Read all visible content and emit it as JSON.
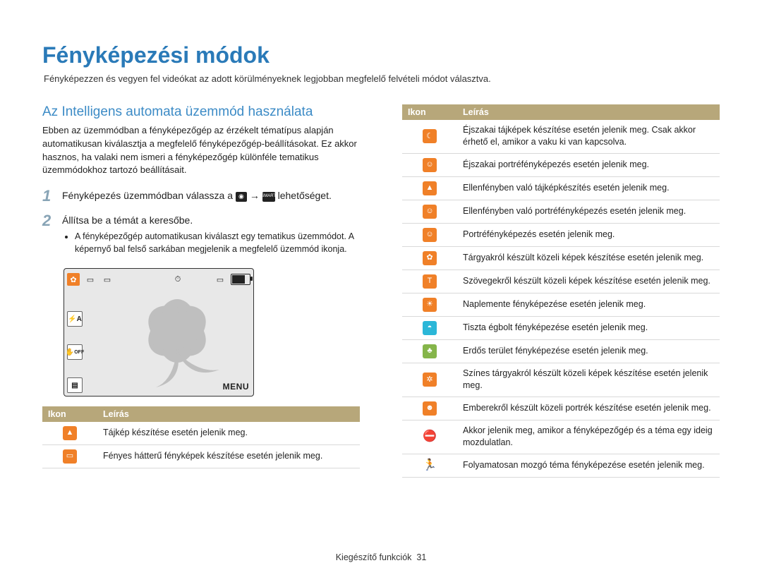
{
  "page": {
    "title": "Fényképezési módok",
    "subtitle": "Fényképezzen és vegyen fel videókat az adott körülményeknek legjobban megfelelő felvételi módot választva."
  },
  "section": {
    "title": "Az Intelligens automata üzemmód használata",
    "body": "Ebben az üzemmódban a fényképezőgép az érzékelt tématípus alapján automatikusan kiválasztja a megfelelő fényképezőgép-beállításokat. Ez akkor hasznos, ha valaki nem ismeri a fényképezőgép különféle tematikus üzemmódokhoz tartozó beállításait."
  },
  "steps": {
    "one_num": "1",
    "one_pre": "Fényképezés üzemmódban válassza a ",
    "one_arrow": " → ",
    "one_post": " lehetőséget.",
    "two_num": "2",
    "two_text": "Állítsa be a témát a keresőbe.",
    "two_bullet": "A fényképezőgép automatikusan kiválaszt egy tematikus üzemmódot. A képernyő bal felső sarkában megjelenik a megfelelő üzemmód ikonja."
  },
  "preview": {
    "menu_label": "MENU"
  },
  "tables": {
    "header_icon": "Ikon",
    "header_desc": "Leírás"
  },
  "left_rows": [
    {
      "icon": "mountain-icon",
      "color": "orange",
      "glyph": "▲",
      "desc": "Tájkép készítése esetén jelenik meg."
    },
    {
      "icon": "white-bg-icon",
      "color": "orange",
      "glyph": "▭",
      "desc": "Fényes hátterű fényképek készítése esetén jelenik meg."
    }
  ],
  "right_rows": [
    {
      "icon": "night-landscape-icon",
      "color": "orange",
      "glyph": "☾",
      "desc": "Éjszakai tájképek készítése esetén jelenik meg. Csak akkor érhető el, amikor a vaku ki van kapcsolva."
    },
    {
      "icon": "night-portrait-icon",
      "color": "orange",
      "glyph": "☺",
      "desc": "Éjszakai portréfényképezés esetén jelenik meg."
    },
    {
      "icon": "backlight-land-icon",
      "color": "orange",
      "glyph": "▲",
      "desc": "Ellenfényben való tájképkészítés esetén jelenik meg."
    },
    {
      "icon": "backlight-port-icon",
      "color": "orange",
      "glyph": "☺",
      "desc": "Ellenfényben való portréfényképezés esetén jelenik meg."
    },
    {
      "icon": "portrait-icon",
      "color": "orange",
      "glyph": "☺",
      "desc": "Portréfényképezés esetén jelenik meg."
    },
    {
      "icon": "macro-icon",
      "color": "orange",
      "glyph": "✿",
      "desc": "Tárgyakról készült közeli képek készítése esetén jelenik meg."
    },
    {
      "icon": "macro-text-icon",
      "color": "orange",
      "glyph": "T",
      "desc": "Szövegekről készült közeli képek készítése esetén jelenik meg."
    },
    {
      "icon": "sunset-icon",
      "color": "orange",
      "glyph": "☀",
      "desc": "Naplemente fényképezése esetén jelenik meg."
    },
    {
      "icon": "sky-icon",
      "color": "cyan",
      "glyph": "◓",
      "desc": "Tiszta égbolt fényképezése esetén jelenik meg."
    },
    {
      "icon": "forest-icon",
      "color": "green",
      "glyph": "♣",
      "desc": "Erdős terület fényképezése esetén jelenik meg."
    },
    {
      "icon": "macro-color-icon",
      "color": "orange",
      "glyph": "✲",
      "desc": "Színes tárgyakról készült közeli képek készítése esetén jelenik meg."
    },
    {
      "icon": "close-portrait-icon",
      "color": "orange",
      "glyph": "☻",
      "desc": "Emberekről készült közeli portrék készítése esetén jelenik meg."
    },
    {
      "icon": "tripod-icon",
      "color": "black",
      "glyph": "⛔",
      "desc": "Akkor jelenik meg, amikor a fényképezőgép és a téma egy ideig mozdulatlan."
    },
    {
      "icon": "action-icon",
      "color": "black",
      "glyph": "🏃",
      "desc": "Folyamatosan mozgó téma fényképezése esetén jelenik meg."
    }
  ],
  "footer": {
    "section": "Kiegészítő funkciók",
    "page_no": "31"
  }
}
